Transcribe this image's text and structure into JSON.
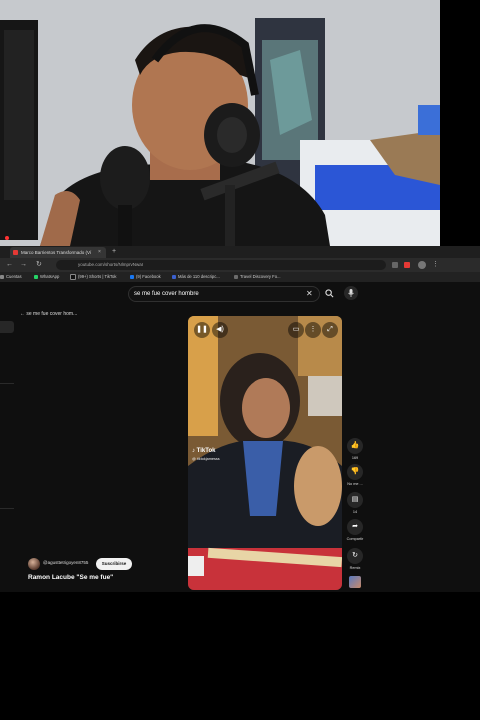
{
  "colors": {
    "youtube_red": "#e53935",
    "page_bg": "#0f0f0f",
    "subscribe_bg": "#f1f1f1"
  },
  "browser": {
    "tab": {
      "title": "Marco Barrientos Transformado (Ví",
      "favicon": "youtube-icon",
      "close": "×"
    },
    "new_tab": "+",
    "nav": {
      "back": "←",
      "forward": "→",
      "reload": "↻"
    },
    "url": "youtube.com/shorts/NlmprvNwaI",
    "bookmarks": [
      {
        "label": "Cuentas",
        "color": "#888888"
      },
      {
        "label": "WhatsApp",
        "color": "#25d366"
      },
      {
        "label": "(99+) Shorts | TikTok",
        "color": "#111111"
      },
      {
        "label": "(9) Facebook",
        "color": "#1877f2"
      },
      {
        "label": "Más de 110 descripc...",
        "color": "#3a5fcd"
      },
      {
        "label": "Travel Discovery Fo...",
        "color": "#6b6b6b"
      }
    ]
  },
  "youtube": {
    "search": {
      "value": "se me fue cover hombre",
      "clear": "✕",
      "search_icon": "search-icon",
      "mic_icon": "mic-icon"
    },
    "back_label": "se me fue cover hom...",
    "channel": "@agusttetrigoyen8755",
    "subscribe": "Suscribirse",
    "title": "Ramon Lacube \"Se me fue\"",
    "tiktok_brand": "TikTok",
    "tiktok_user": "@ tiktokjamesss",
    "actions": {
      "likes": "169",
      "dislike_label": "No me ...",
      "comments": "14",
      "share_label": "Compartir",
      "remix_label": "Remix"
    }
  }
}
